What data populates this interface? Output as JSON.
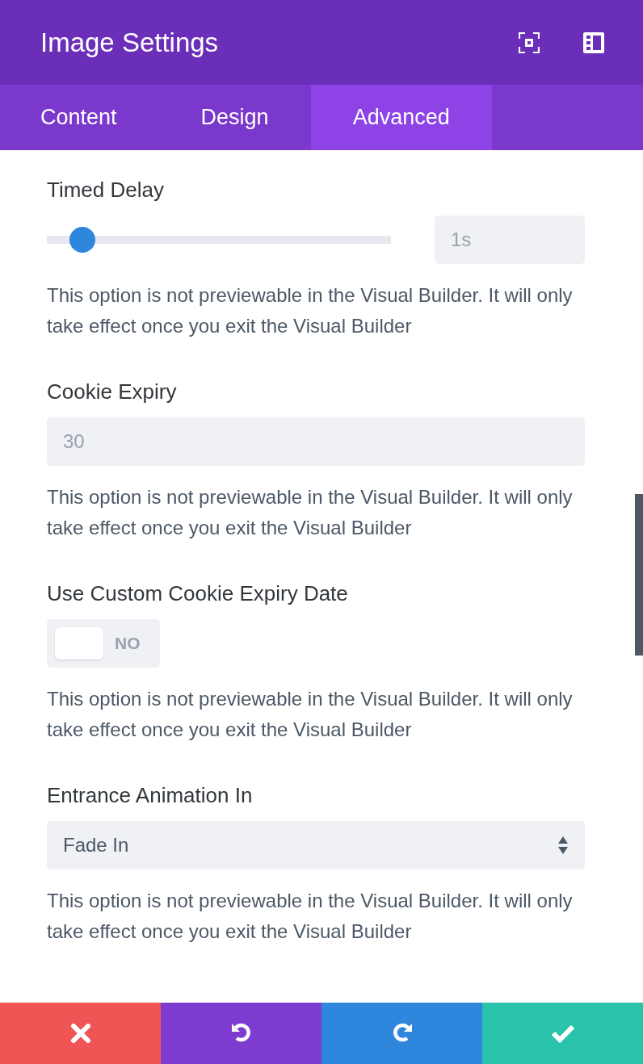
{
  "header": {
    "title": "Image Settings"
  },
  "tabs": [
    {
      "label": "Content",
      "selected": false
    },
    {
      "label": "Design",
      "selected": false
    },
    {
      "label": "Advanced",
      "selected": true
    }
  ],
  "settings": [
    {
      "kind": "slider",
      "label": "Timed Delay",
      "level": 0.07,
      "placeholder": "1s",
      "description": "This option is not previewable in the Visual Builder. It will only take effect once you exit the Visual Builder"
    },
    {
      "kind": "number",
      "label": "Cookie Expiry",
      "placeholder": "30",
      "description": "This option is not previewable in the Visual Builder. It will only take effect once you exit the Visual Builder"
    },
    {
      "kind": "toggle",
      "label": "Use Custom Cookie Expiry Date",
      "on": false,
      "state_text": "NO",
      "description": "This option is not previewable in the Visual Builder. It will only take effect once you exit the Visual Builder"
    },
    {
      "kind": "select",
      "label": "Entrance Animation In",
      "value": "Fade In",
      "description": "This option is not previewable in the Visual Builder. It will only take effect once you exit the Visual Builder"
    }
  ],
  "footer_buttons": [
    {
      "kind": "cancel"
    },
    {
      "kind": "undo"
    },
    {
      "kind": "redo"
    },
    {
      "kind": "save"
    }
  ]
}
